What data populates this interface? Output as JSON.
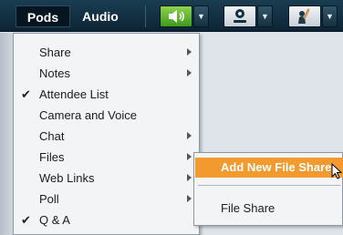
{
  "menubar": {
    "items": [
      "Pods",
      "Audio"
    ]
  },
  "toolbar": {
    "speaker_icon": "speaker-icon",
    "camera_icon": "webcam-icon",
    "status_icon": "raise-hand-icon",
    "dropdown_glyph": "▼"
  },
  "pods_menu": {
    "items": [
      {
        "label": "Share",
        "checked": false,
        "submenu": true
      },
      {
        "label": "Notes",
        "checked": false,
        "submenu": true
      },
      {
        "label": "Attendee List",
        "checked": true,
        "submenu": false
      },
      {
        "label": "Camera and Voice",
        "checked": false,
        "submenu": false
      },
      {
        "label": "Chat",
        "checked": false,
        "submenu": true
      },
      {
        "label": "Files",
        "checked": false,
        "submenu": true
      },
      {
        "label": "Web Links",
        "checked": false,
        "submenu": true
      },
      {
        "label": "Poll",
        "checked": false,
        "submenu": true
      },
      {
        "label": "Q & A",
        "checked": true,
        "submenu": false
      }
    ],
    "check_glyph": "✔"
  },
  "files_submenu": {
    "add_label": "Add New File Share",
    "share_label": "File Share"
  },
  "colors": {
    "highlight": "#f29a2e",
    "topbar": "#0c2435",
    "speaker_green": "#3e9a1c"
  }
}
